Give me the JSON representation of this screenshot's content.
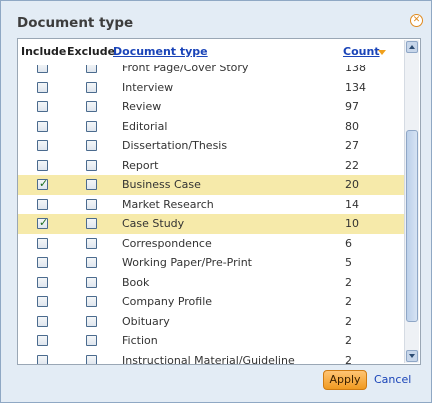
{
  "dialog": {
    "title": "Document type",
    "close_icon": "close-circle-icon",
    "accent_color": "#e08a1e"
  },
  "columns": {
    "include": "Include",
    "exclude": "Exclude",
    "document_type": "Document type",
    "count": "Count"
  },
  "rows": [
    {
      "label": "Front Page/Cover Story",
      "count": "138",
      "include": false,
      "exclude": false
    },
    {
      "label": "Interview",
      "count": "134",
      "include": false,
      "exclude": false
    },
    {
      "label": "Review",
      "count": "97",
      "include": false,
      "exclude": false
    },
    {
      "label": "Editorial",
      "count": "80",
      "include": false,
      "exclude": false
    },
    {
      "label": "Dissertation/Thesis",
      "count": "27",
      "include": false,
      "exclude": false
    },
    {
      "label": "Report",
      "count": "22",
      "include": false,
      "exclude": false
    },
    {
      "label": "Business Case",
      "count": "20",
      "include": true,
      "exclude": false
    },
    {
      "label": "Market Research",
      "count": "14",
      "include": false,
      "exclude": false
    },
    {
      "label": "Case Study",
      "count": "10",
      "include": true,
      "exclude": false
    },
    {
      "label": "Correspondence",
      "count": "6",
      "include": false,
      "exclude": false
    },
    {
      "label": "Working Paper/Pre-Print",
      "count": "5",
      "include": false,
      "exclude": false
    },
    {
      "label": "Book",
      "count": "2",
      "include": false,
      "exclude": false
    },
    {
      "label": "Company Profile",
      "count": "2",
      "include": false,
      "exclude": false
    },
    {
      "label": "Obituary",
      "count": "2",
      "include": false,
      "exclude": false
    },
    {
      "label": "Fiction",
      "count": "2",
      "include": false,
      "exclude": false
    },
    {
      "label": "Instructional Material/Guideline",
      "count": "2",
      "include": false,
      "exclude": false
    }
  ],
  "footer": {
    "apply_label": "Apply",
    "cancel_label": "Cancel"
  },
  "colors": {
    "selected_row": "#f6eaaa",
    "link": "#1a44b8",
    "apply_button": "#f09a21"
  }
}
